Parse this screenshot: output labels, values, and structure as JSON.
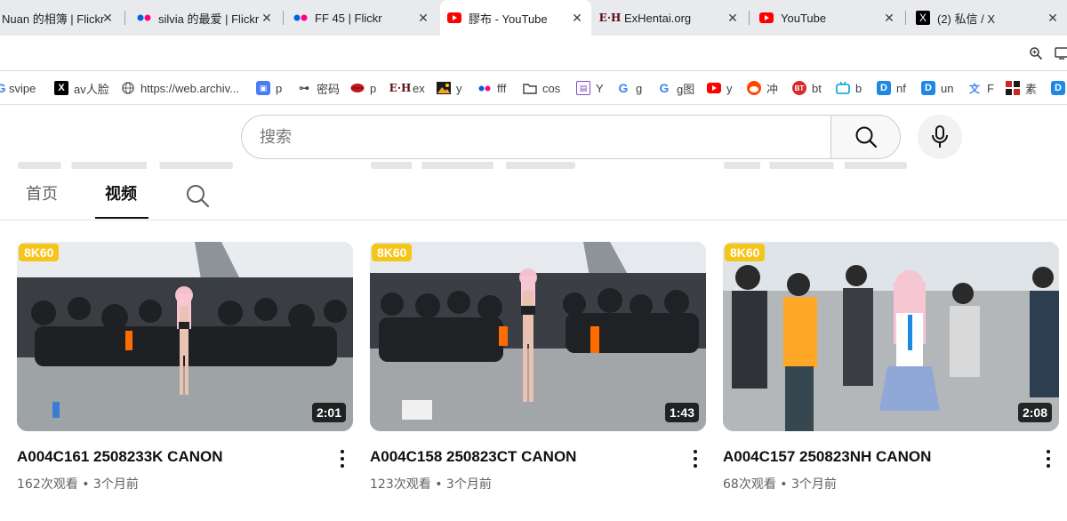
{
  "tabs": [
    {
      "title": "Nuan 的相簿 | Flickr",
      "favicon": "flickr-icon",
      "active": false
    },
    {
      "title": "silvia 的最爱 | Flickr",
      "favicon": "flickr-icon",
      "active": false
    },
    {
      "title": "FF 45 | Flickr",
      "favicon": "flickr-icon",
      "active": false
    },
    {
      "title": "膠布 - YouTube",
      "favicon": "youtube-icon",
      "active": true
    },
    {
      "title": "ExHentai.org",
      "favicon": "exhentai-icon",
      "active": false
    },
    {
      "title": "YouTube",
      "favicon": "youtube-icon",
      "active": false
    },
    {
      "title": "(2) 私信 / X",
      "favicon": "x-icon",
      "active": false
    }
  ],
  "toolbar": {
    "zoom_icon": "zoom-icon",
    "cast_icon": "cast-icon"
  },
  "bookmarks": [
    {
      "label": "svipe",
      "icon": "google-icon"
    },
    {
      "label": "av人脸",
      "icon": "x-icon"
    },
    {
      "label": "https://web.archiv...",
      "icon": "globe-icon"
    },
    {
      "label": "p",
      "icon": "bilibili-icon"
    },
    {
      "label": "密码",
      "icon": "key-icon"
    },
    {
      "label": "p",
      "icon": "lips-icon"
    },
    {
      "label": "ex",
      "icon": "exhentai-icon"
    },
    {
      "label": "y",
      "icon": "image-icon"
    },
    {
      "label": "fff",
      "icon": "flickr-icon"
    },
    {
      "label": "cos",
      "icon": "folder-icon"
    },
    {
      "label": "Y",
      "icon": "yandex-icon"
    },
    {
      "label": "g",
      "icon": "google-icon"
    },
    {
      "label": "g图",
      "icon": "google-icon"
    },
    {
      "label": "y",
      "icon": "youtube-icon"
    },
    {
      "label": "冲",
      "icon": "reddit-icon"
    },
    {
      "label": "bt",
      "icon": "bt-icon"
    },
    {
      "label": "b",
      "icon": "bilibili-tv-icon"
    },
    {
      "label": "nf",
      "icon": "d-icon"
    },
    {
      "label": "un",
      "icon": "d-icon"
    },
    {
      "label": "F",
      "icon": "translate-icon"
    },
    {
      "label": "素",
      "icon": "grid-icon"
    },
    {
      "label": "",
      "icon": "d-icon"
    }
  ],
  "search": {
    "placeholder": "搜索",
    "value": ""
  },
  "channel_tabs": [
    {
      "label": "首页",
      "selected": false
    },
    {
      "label": "视频",
      "selected": true
    }
  ],
  "videos": [
    {
      "badge": "8K60",
      "duration": "2:01",
      "title": "A004C161 2508233K CANON",
      "views": "162次观看",
      "age": "3个月前"
    },
    {
      "badge": "8K60",
      "duration": "1:43",
      "title": "A004C158 250823CT CANON",
      "views": "123次观看",
      "age": "3个月前"
    },
    {
      "badge": "8K60",
      "duration": "2:08",
      "title": "A004C157 250823NH CANON",
      "views": "68次观看",
      "age": "3个月前"
    }
  ],
  "meta_separator": "•",
  "colors": {
    "youtube_red": "#ff0000",
    "badge_yellow": "#f5c518",
    "flickr_pink": "#ff0084",
    "flickr_blue": "#0063dc"
  }
}
